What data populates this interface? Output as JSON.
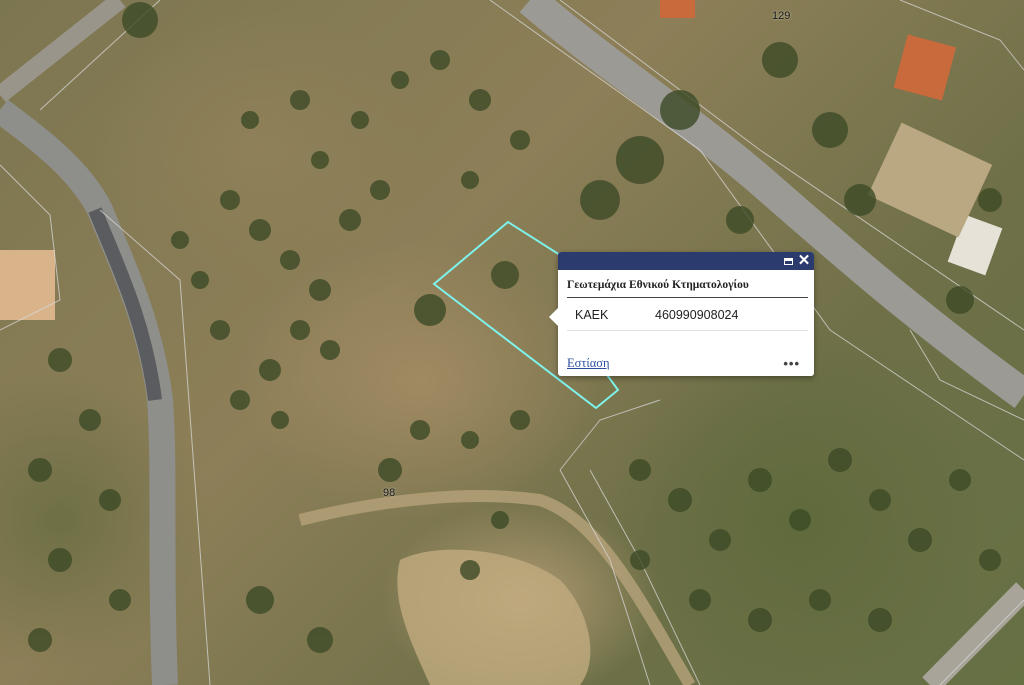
{
  "map": {
    "parcel_labels": [
      "129",
      "98"
    ]
  },
  "popup": {
    "title": "Γεωτεμάχια Εθνικού Κτηματολογίου",
    "field_key": "ΚΑΕΚ",
    "field_value": "460990908024",
    "zoom_label": "Εστίαση",
    "more_label": "•••",
    "maximize_icon": "maximize-icon",
    "close_icon": "close-icon",
    "close_glyph": "✕"
  },
  "colors": {
    "popup_header": "#2b3b6e",
    "selected_parcel_outline": "#7ff2ec",
    "parcel_lines": "#d8d8d8",
    "link": "#2b4ea1"
  }
}
